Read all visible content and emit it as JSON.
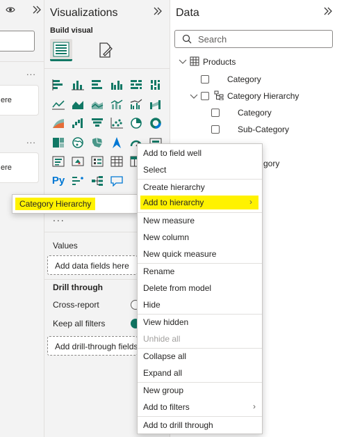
{
  "left_pane": {
    "eye_icon": "eye-icon",
    "expand_icon": "double-chevron-right-icon",
    "more_1": "...",
    "more_2": "...",
    "card_1_text": "ere",
    "card_2_text": "ere"
  },
  "visualizations": {
    "title": "Visualizations",
    "collapse_icon": "double-chevron-right-icon",
    "build_visual": "Build visual",
    "more_visuals": "...",
    "values_label": "Values",
    "values_well": "Add data fields here",
    "drill_through_label": "Drill through",
    "cross_report_label": "Cross-report",
    "keep_filters_label": "Keep all filters",
    "drill_well": "Add drill-through fields here",
    "accent_color": "#117865"
  },
  "data_pane": {
    "title": "Data",
    "collapse_icon": "double-chevron-right-icon",
    "search_placeholder": "Search",
    "tree": {
      "products": "Products",
      "category": "Category",
      "category_hierarchy": "Category Hierarchy",
      "h_category": "Category",
      "h_sub_category": "Sub-Category",
      "partial_item": "gory"
    }
  },
  "context_menu": {
    "items": [
      {
        "label": "Add to field well"
      },
      {
        "label": "Select"
      },
      {
        "label": "Create hierarchy"
      },
      {
        "label": "Add to hierarchy",
        "highlight": true,
        "submenu": true
      },
      {
        "label": "New measure"
      },
      {
        "label": "New column"
      },
      {
        "label": "New quick measure"
      },
      {
        "label": "Rename"
      },
      {
        "label": "Delete from model"
      },
      {
        "label": "Hide"
      },
      {
        "label": "View hidden"
      },
      {
        "label": "Unhide all",
        "disabled": true
      },
      {
        "label": "Collapse all"
      },
      {
        "label": "Expand all"
      },
      {
        "label": "New group"
      },
      {
        "label": "Add to filters",
        "submenu": true
      },
      {
        "label": "Add to drill through"
      }
    ],
    "highlight_color": "#fff200"
  },
  "submenu": {
    "item": "Category Hierarchy"
  }
}
